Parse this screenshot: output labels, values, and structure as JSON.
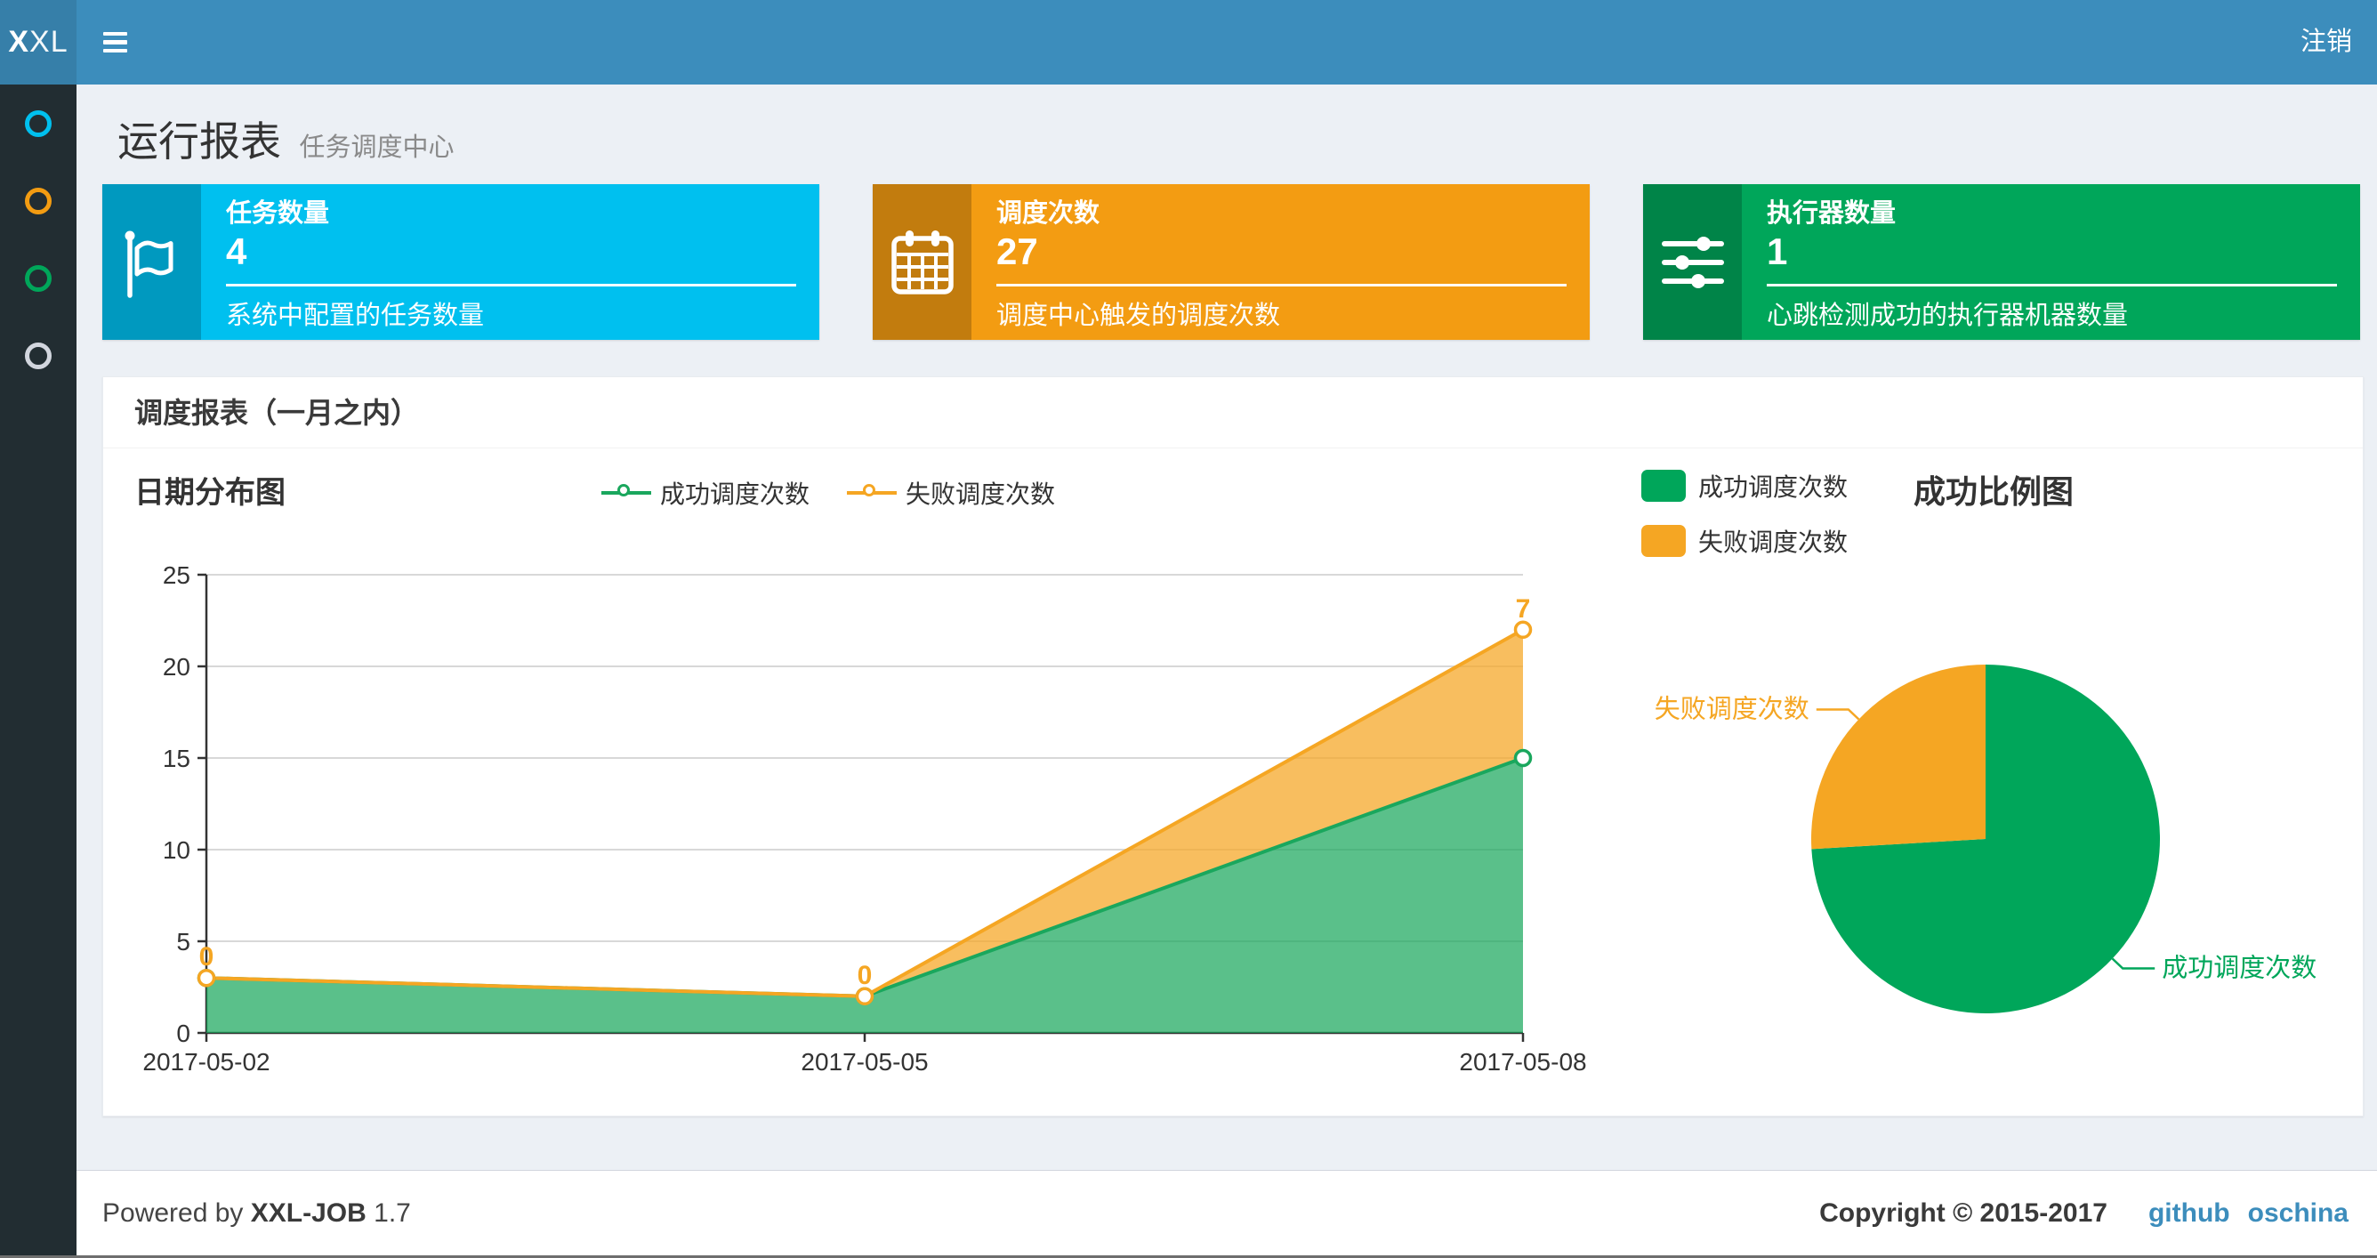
{
  "header": {
    "logo_bold": "X",
    "logo_rest": "XL",
    "logout_label": "注销"
  },
  "sidebar": {
    "items": [
      {
        "name": "menu-dot-aqua",
        "color": "#00C0EF"
      },
      {
        "name": "menu-dot-yellow",
        "color": "#F39C12"
      },
      {
        "name": "menu-dot-green",
        "color": "#00A65A"
      },
      {
        "name": "menu-dot-gray",
        "color": "#D2D6DE"
      }
    ]
  },
  "page_header": {
    "title": "运行报表",
    "subtitle": "任务调度中心"
  },
  "stat_cards": [
    {
      "label": "任务数量",
      "value": "4",
      "description": "系统中配置的任务数量",
      "color": "#00C0EF",
      "icon": "flag-icon"
    },
    {
      "label": "调度次数",
      "value": "27",
      "description": "调度中心触发的调度次数",
      "color": "#F39C12",
      "icon": "calendar-icon"
    },
    {
      "label": "执行器数量",
      "value": "1",
      "description": "心跳检测成功的执行器机器数量",
      "color": "#00A65A",
      "icon": "sliders-icon"
    }
  ],
  "panel": {
    "title": "调度报表（一月之内）"
  },
  "chart_data": [
    {
      "type": "area",
      "title": "日期分布图",
      "categories": [
        "2017-05-02",
        "2017-05-05",
        "2017-05-08"
      ],
      "series": [
        {
          "name": "成功调度次数",
          "values": [
            3,
            2,
            15
          ],
          "color": "#1AA75D",
          "fill": "rgba(26,167,93,0.72)"
        },
        {
          "name": "失败调度次数",
          "values": [
            0,
            0,
            7
          ],
          "color": "#F5A623",
          "fill": "rgba(245,166,35,0.73)"
        }
      ],
      "stacked": true,
      "ylim": [
        0,
        25
      ],
      "y_ticks": [
        0,
        5,
        10,
        15,
        20,
        25
      ],
      "point_labels": {
        "series": "失败调度次数",
        "values": [
          "0",
          "0",
          "7"
        ]
      },
      "grid": true,
      "legend_position": "top-center"
    },
    {
      "type": "pie",
      "title": "成功比例图",
      "labels": [
        "成功调度次数",
        "失败调度次数"
      ],
      "values": [
        20,
        7
      ],
      "colors": [
        "#00A65A",
        "#F5A623"
      ],
      "legend_position": "top-left"
    }
  ],
  "footer": {
    "powered_prefix": "Powered by ",
    "brand": "XXL-JOB",
    "version": " 1.7",
    "copyright": "Copyright © 2015-2017",
    "links": [
      "github",
      "oschina"
    ]
  }
}
